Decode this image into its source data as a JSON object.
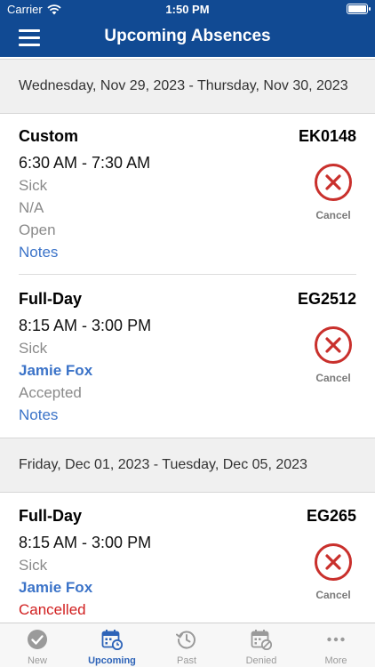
{
  "status_bar": {
    "carrier": "Carrier",
    "time": "1:50 PM"
  },
  "nav": {
    "title": "Upcoming Absences"
  },
  "sections": [
    {
      "date_range": "Wednesday, Nov 29, 2023 - Thursday, Nov 30, 2023",
      "absences": [
        {
          "type": "Custom",
          "code": "EK0148",
          "time": "6:30 AM - 7:30 AM",
          "reason": "Sick",
          "substitute": "N/A",
          "status": "Open",
          "notes_label": "Notes",
          "cancel_label": "Cancel"
        },
        {
          "type": "Full-Day",
          "code": "EG2512",
          "time": "8:15 AM - 3:00 PM",
          "reason": "Sick",
          "substitute": "Jamie Fox",
          "status": "Accepted",
          "notes_label": "Notes",
          "cancel_label": "Cancel"
        }
      ]
    },
    {
      "date_range": "Friday, Dec 01, 2023 - Tuesday, Dec 05, 2023",
      "absences": [
        {
          "type": "Full-Day",
          "code": "EG265",
          "time": "8:15 AM - 3:00 PM",
          "reason": "Sick",
          "substitute": "Jamie Fox",
          "status": "Cancelled",
          "cancel_label": "Cancel"
        }
      ]
    }
  ],
  "tabs": [
    {
      "label": "New",
      "icon": "checkmark-circle-icon",
      "active": false
    },
    {
      "label": "Upcoming",
      "icon": "calendar-clock-icon",
      "active": true
    },
    {
      "label": "Past",
      "icon": "history-icon",
      "active": false
    },
    {
      "label": "Denied",
      "icon": "calendar-denied-icon",
      "active": false
    },
    {
      "label": "More",
      "icon": "more-dots-icon",
      "active": false
    }
  ],
  "colors": {
    "header_bg": "#114a93",
    "accent_blue": "#3b73c8",
    "cancel_red": "#c9302c",
    "cancelled_text": "#d11f1f",
    "active_tab": "#2d63b8"
  }
}
